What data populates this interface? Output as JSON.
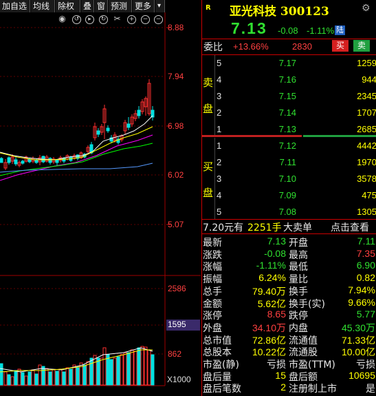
{
  "toolbar": {
    "tabs": [
      "加自选",
      "均线",
      "除权",
      "叠",
      "窗",
      "预测",
      "更多"
    ],
    "menu_glyph": "▾"
  },
  "chart": {
    "price_labels": [
      "8.88",
      "7.94",
      "6.98",
      "6.02",
      "5.07"
    ],
    "volume_labels": [
      "2586",
      "1595",
      "862"
    ],
    "volume_unit": "X1000",
    "colors": {
      "up": "#ff3030",
      "down": "#00e0e0",
      "ma5": "#ffffff",
      "ma10": "#ffff00",
      "ma20": "#ff00ff",
      "ma30": "#00ff00",
      "ma60": "#5599ff"
    }
  },
  "quote": {
    "tag": "R",
    "name": "亚光科技 300123",
    "price": "7.13",
    "change": "-0.08",
    "change_pct": "-1.11%",
    "badge": "陆",
    "weibi_label": "委比",
    "weibi_pct": "+13.66%",
    "weibi_diff": "2830",
    "buy_btn": "买",
    "sell_btn": "卖"
  },
  "orderbook": {
    "sell_label": [
      "卖",
      "盘"
    ],
    "buy_label": [
      "买",
      "盘"
    ],
    "asks": [
      {
        "idx": "5",
        "price": "7.17",
        "vol": "1259"
      },
      {
        "idx": "4",
        "price": "7.16",
        "vol": "944"
      },
      {
        "idx": "3",
        "price": "7.15",
        "vol": "2345"
      },
      {
        "idx": "2",
        "price": "7.14",
        "vol": "1707"
      },
      {
        "idx": "1",
        "price": "7.13",
        "vol": "2685"
      }
    ],
    "bids": [
      {
        "idx": "1",
        "price": "7.12",
        "vol": "4442"
      },
      {
        "idx": "2",
        "price": "7.11",
        "vol": "1970"
      },
      {
        "idx": "3",
        "price": "7.10",
        "vol": "3578"
      },
      {
        "idx": "4",
        "price": "7.09",
        "vol": "475"
      },
      {
        "idx": "5",
        "price": "7.08",
        "vol": "1305"
      }
    ]
  },
  "big_order": {
    "price": "7.20元有",
    "vol": "2251手",
    "label": "大卖单",
    "link": "点击查看"
  },
  "stats": [
    {
      "l1": "最新",
      "v1": "7.13",
      "c1": "green",
      "l2": "开盘",
      "v2": "7.11",
      "c2": "green"
    },
    {
      "l1": "涨跌",
      "v1": "-0.08",
      "c1": "green",
      "l2": "最高",
      "v2": "7.35",
      "c2": "red"
    },
    {
      "l1": "涨幅",
      "v1": "-1.11%",
      "c1": "green",
      "l2": "最低",
      "v2": "6.90",
      "c2": "green"
    },
    {
      "l1": "振幅",
      "v1": "6.24%",
      "c1": "yellow",
      "l2": "量比",
      "v2": "0.82",
      "c2": "yellow"
    },
    {
      "l1": "总手",
      "v1": "79.40万",
      "c1": "yellow",
      "l2": "换手",
      "v2": "7.94%",
      "c2": "yellow"
    },
    {
      "l1": "金额",
      "v1": "5.62亿",
      "c1": "yellow",
      "l2": "换手(实)",
      "v2": "9.66%",
      "c2": "yellow"
    },
    {
      "l1": "涨停",
      "v1": "8.65",
      "c1": "red",
      "l2": "跌停",
      "v2": "5.77",
      "c2": "green"
    },
    {
      "l1": "外盘",
      "v1": "34.10万",
      "c1": "red",
      "l2": "内盘",
      "v2": "45.30万",
      "c2": "green"
    },
    {
      "l1": "总市值",
      "v1": "72.86亿",
      "c1": "yellow",
      "l2": "流通值",
      "v2": "71.33亿",
      "c2": "yellow"
    },
    {
      "l1": "总股本",
      "v1": "10.22亿",
      "c1": "yellow",
      "l2": "流通股",
      "v2": "10.00亿",
      "c2": "yellow"
    },
    {
      "l1": "市盈(静)",
      "v1": "亏损",
      "c1": "white",
      "l2": "市盈(TTM)",
      "v2": "亏损",
      "c2": "white"
    },
    {
      "l1": "盘后量",
      "v1": "15",
      "c1": "yellow",
      "l2": "盘后额",
      "v2": "10695",
      "c2": "yellow"
    },
    {
      "l1": "盘后笔数",
      "v1": "2",
      "c1": "yellow",
      "l2": "注册制上市",
      "v2": "是",
      "c2": "white"
    }
  ]
}
